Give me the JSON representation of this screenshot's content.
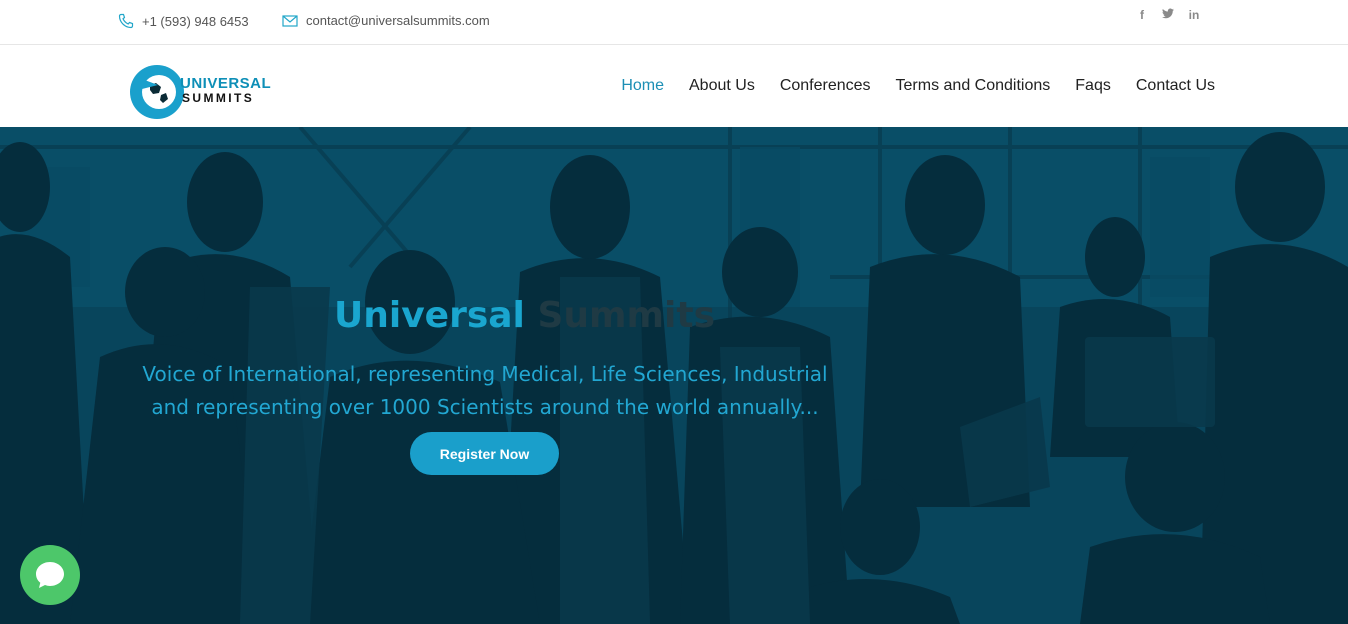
{
  "topbar": {
    "phone": "+1 (593) 948 6453",
    "email": "contact@universalsummits.com",
    "social": [
      {
        "icon": "facebook-icon",
        "glyph": "f"
      },
      {
        "icon": "twitter-icon",
        "glyph": "t"
      },
      {
        "icon": "linkedin-icon",
        "glyph": "in"
      }
    ]
  },
  "logo": {
    "line1": "UNIVERSAL",
    "line2": "SUMMITS"
  },
  "nav": {
    "items": [
      "Home",
      "About Us",
      "Conferences",
      "Terms and Conditions",
      "Faqs",
      "Contact Us"
    ],
    "active": "Home"
  },
  "hero": {
    "title_part1": "Universal",
    "title_part2": "Summits",
    "subtitle": "Voice of International, representing Medical, Life Sciences, Industrial and representing over 1000 Scientists around the world annually...",
    "cta_label": "Register Now"
  },
  "colors": {
    "accent": "#1a9fcb",
    "chat": "#4dc76a"
  }
}
